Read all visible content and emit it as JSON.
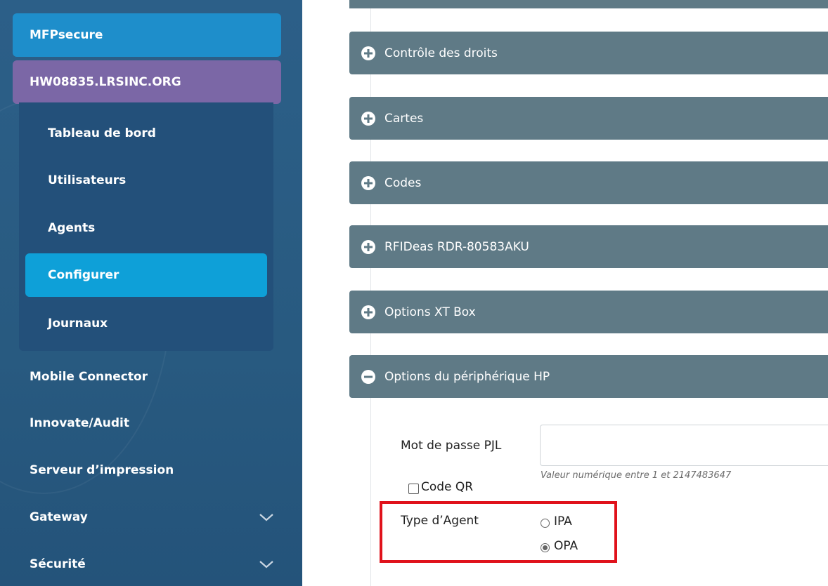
{
  "sidebar": {
    "product": "MFPsecure",
    "host": "HW08835.LRSINC.ORG",
    "sub_items": [
      {
        "label": "Tableau de bord"
      },
      {
        "label": "Utilisateurs"
      },
      {
        "label": "Agents"
      },
      {
        "label": "Configurer",
        "active": true
      },
      {
        "label": "Journaux"
      }
    ],
    "items": [
      {
        "label": "Mobile Connector"
      },
      {
        "label": "Innovate/Audit"
      },
      {
        "label": "Serveur d’impression"
      },
      {
        "label": "Gateway",
        "icon": "chevron-down-icon"
      },
      {
        "label": "Sécurité",
        "icon": "chevron-down-icon"
      }
    ]
  },
  "panels": [
    {
      "label": "Contrôle des droits",
      "icon": "plus-circle-icon"
    },
    {
      "label": "Cartes",
      "icon": "plus-circle-icon"
    },
    {
      "label": "Codes",
      "icon": "plus-circle-icon"
    },
    {
      "label": "RFIDeas RDR-80583AKU",
      "icon": "plus-circle-icon"
    },
    {
      "label": "Options XT Box",
      "icon": "plus-circle-icon"
    },
    {
      "label": "Options du périphérique HP",
      "icon": "minus-circle-icon",
      "expanded": true
    }
  ],
  "hp_options": {
    "pjl_label": "Mot de passe PJL",
    "pjl_value": "",
    "pjl_hint": "Valeur numérique entre 1 et 2147483647",
    "qr_label": "Code QR",
    "qr_checked": false,
    "agent_type_label": "Type d’Agent",
    "agent_types": [
      {
        "label": "IPA",
        "checked": false
      },
      {
        "label": "OPA",
        "checked": true
      }
    ]
  },
  "colors": {
    "sidebar": "#2a5b84",
    "product_tab": "#1e8ecb",
    "host_tab": "#7b67a6",
    "active_item": "#0ea0d8",
    "panel_header": "#5f7a86",
    "highlight": "#e0121b"
  }
}
